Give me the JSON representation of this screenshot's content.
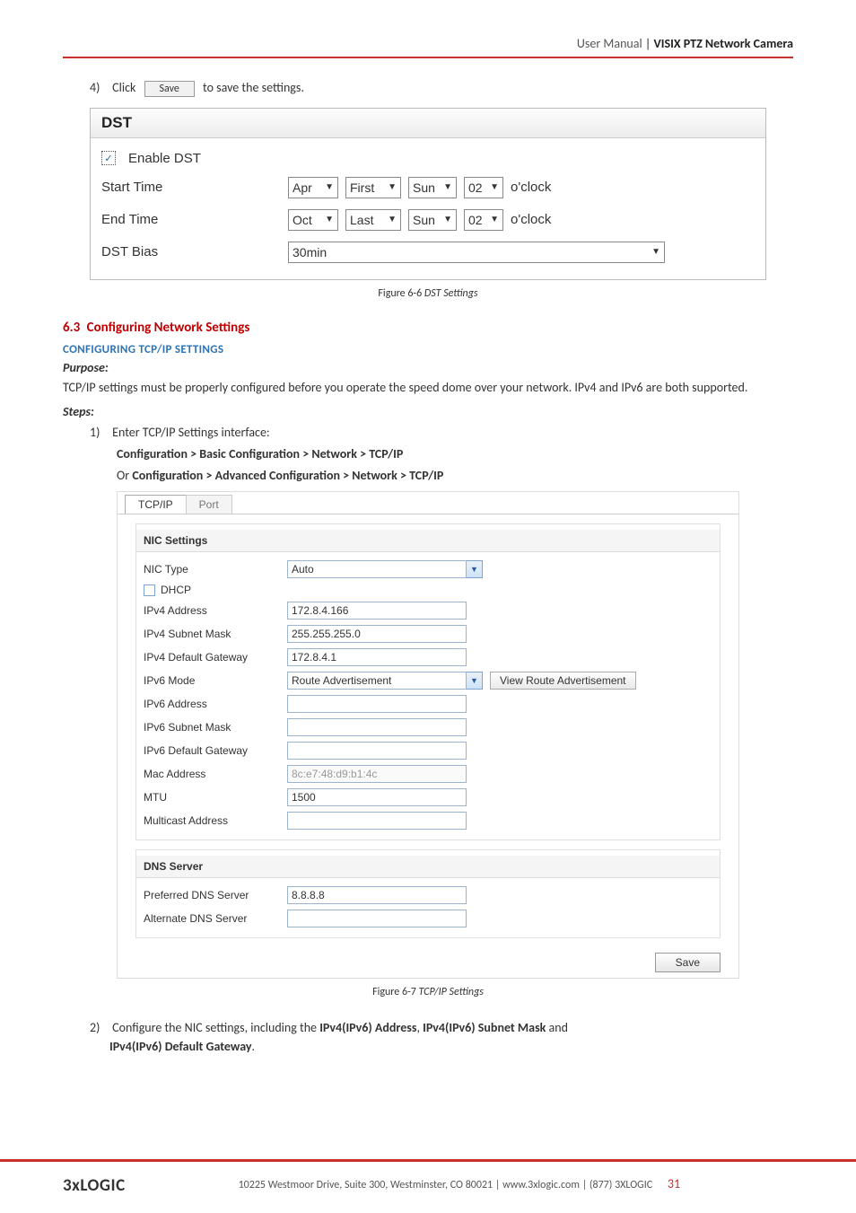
{
  "header": {
    "light": "User Manual",
    "sep": " | ",
    "bold": "VISIX PTZ Network Camera"
  },
  "step4": {
    "num": "4)",
    "before": "Click",
    "save_btn": "Save",
    "after": "to save the settings."
  },
  "dst": {
    "title": "DST",
    "enable_label": "Enable DST",
    "check_glyph": "✓",
    "rows": {
      "start": {
        "label": "Start Time",
        "month": "Apr",
        "week": "First",
        "day": "Sun",
        "hour": "02",
        "oclock": "o'clock"
      },
      "end": {
        "label": "End Time",
        "month": "Oct",
        "week": "Last",
        "day": "Sun",
        "hour": "02",
        "oclock": "o'clock"
      },
      "bias": {
        "label": "DST Bias",
        "value": "30min"
      }
    }
  },
  "caption_dst": {
    "prefix": "Figure 6-6 ",
    "ital": "DST Settings"
  },
  "sec63": {
    "num": "6.3",
    "title": "Configuring Network Settings"
  },
  "conf_h": "CONFIGURING TCP/IP SETTINGS",
  "purpose_h": "Purpose:",
  "body1": "TCP/IP settings must be properly configured before you operate the speed dome over your network. IPv4 and IPv6 are both supported.",
  "steps_h": "Steps:",
  "step1": {
    "num": "1)",
    "text": "Enter TCP/IP Settings interface:"
  },
  "path1": "Configuration > Basic Configuration > Network > TCP/IP",
  "path_or": "Or ",
  "path2": "Configuration > Advanced Configuration > Network > TCP/IP",
  "tcp": {
    "tabs": {
      "active": "TCP/IP",
      "inactive": "Port"
    },
    "nic_head": "NIC Settings",
    "nic_type_lbl": "NIC Type",
    "nic_type_val": "Auto",
    "dhcp_lbl": "DHCP",
    "ipv4addr_lbl": "IPv4 Address",
    "ipv4addr_val": "172.8.4.166",
    "ipv4mask_lbl": "IPv4 Subnet Mask",
    "ipv4mask_val": "255.255.255.0",
    "ipv4gw_lbl": "IPv4 Default Gateway",
    "ipv4gw_val": "172.8.4.1",
    "ipv6mode_lbl": "IPv6 Mode",
    "ipv6mode_val": "Route Advertisement",
    "view_btn": "View Route Advertisement",
    "ipv6addr_lbl": "IPv6 Address",
    "ipv6mask_lbl": "IPv6 Subnet Mask",
    "ipv6gw_lbl": "IPv6 Default Gateway",
    "mac_lbl": "Mac Address",
    "mac_val": "8c:e7:48:d9:b1:4c",
    "mtu_lbl": "MTU",
    "mtu_val": "1500",
    "mcast_lbl": "Multicast Address",
    "dns_head": "DNS Server",
    "pdns_lbl": "Preferred DNS Server",
    "pdns_val": "8.8.8.8",
    "adns_lbl": "Alternate DNS Server",
    "save_btn": "Save"
  },
  "caption_tcp": {
    "prefix": "Figure 6-7  ",
    "ital": "TCP/IP Settings"
  },
  "step2": {
    "num": "2)",
    "t1": "Configure the NIC settings, including the ",
    "b1": "IPv4(IPv6) Address",
    "t2": ", ",
    "b2": "IPv4(IPv6) Subnet Mask",
    "t3": " and ",
    "b3": "IPv4(IPv6) Default Gateway",
    "t4": "."
  },
  "footer": {
    "logo": "3xLOGIC",
    "text": "10225 Westmoor Drive, Suite 300, Westminster, CO 80021 | www.3xlogic.com | (877) 3XLOGIC",
    "page": "31"
  }
}
